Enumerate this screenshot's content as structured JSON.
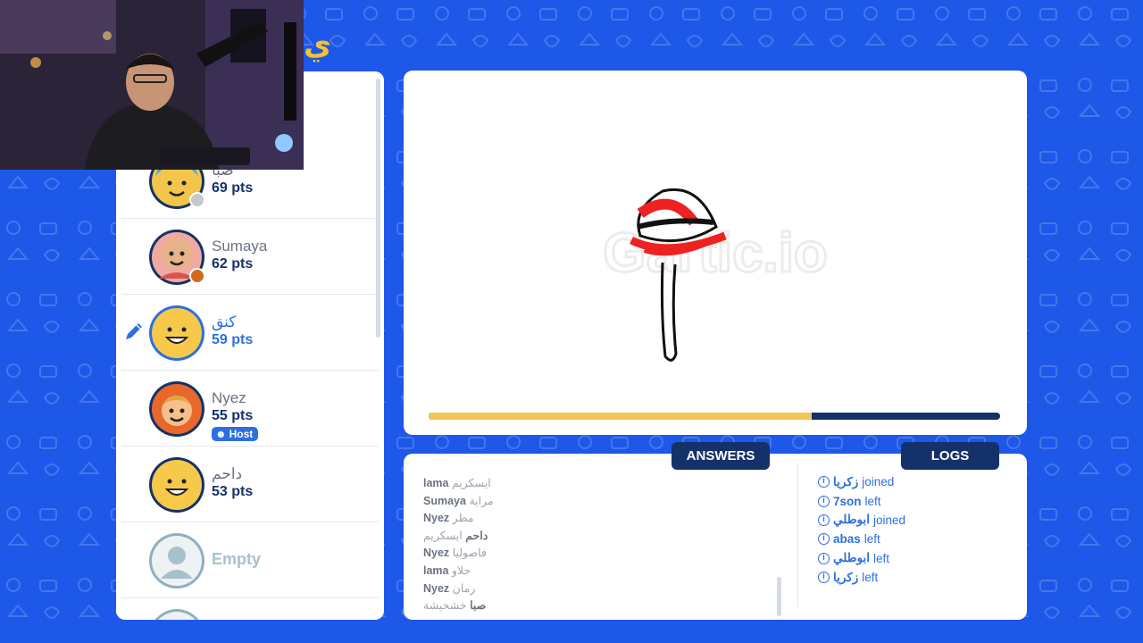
{
  "colors": {
    "background": "#1d58e8",
    "panel": "#ffffff",
    "navy": "#143269",
    "accent_blue": "#2d6fe0",
    "progress_fill": "#f1c653"
  },
  "players": [
    {
      "name": "صبا",
      "points": "69 pts",
      "avatar": "boy-blue-hair-avatar",
      "status_color": "#c4c7cc"
    },
    {
      "name": "Sumaya",
      "points": "62 pts",
      "avatar": "bald-avatar",
      "status_color": "#d2691e"
    },
    {
      "name": "كنق",
      "points": "59 pts",
      "avatar": "smiling-yellow-avatar",
      "drawing": true
    },
    {
      "name": "Nyez",
      "points": "55 pts",
      "avatar": "curly-hair-avatar",
      "host_label": "Host"
    },
    {
      "name": "داحم",
      "points": "53 pts",
      "avatar": "smiling-yellow-avatar"
    },
    {
      "name": "Empty",
      "points": "",
      "avatar": "empty-slot-avatar"
    }
  ],
  "canvas": {
    "watermark": "Gartic.io",
    "progress_fraction": 0.67
  },
  "tabs": {
    "answers_label": "ANSWERS",
    "logs_label": "LOGS"
  },
  "answers": [
    {
      "who": "lama",
      "what": "ايسكريم"
    },
    {
      "who": "Sumaya",
      "what": "مراية"
    },
    {
      "who": "Nyez",
      "what": "مطر"
    },
    {
      "who": "داحم",
      "what": "ايسكريم"
    },
    {
      "who": "Nyez",
      "what": "فاصوليا"
    },
    {
      "who": "lama",
      "what": "حلاو"
    },
    {
      "who": "Nyez",
      "what": "رمان"
    },
    {
      "who": "صبا",
      "what": "خشخيشة"
    }
  ],
  "logs": [
    {
      "who": "زكريا",
      "action": "joined"
    },
    {
      "who": "7son",
      "action": "left"
    },
    {
      "who": "ابوطلي",
      "action": "joined"
    },
    {
      "who": "abas",
      "action": "left"
    },
    {
      "who": "ابوطلي",
      "action": "left"
    },
    {
      "who": "زكريا",
      "action": "left"
    }
  ],
  "logo_fragment": "ي"
}
